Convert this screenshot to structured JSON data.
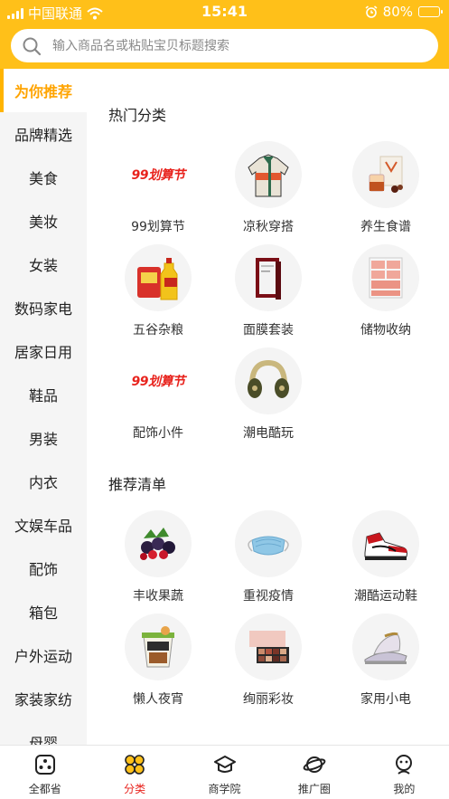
{
  "status_bar": {
    "carrier": "中国联通",
    "time": "15:41",
    "battery": "80%",
    "battery_level": 0.8
  },
  "search": {
    "placeholder": "输入商品名或粘贴宝贝标题搜索"
  },
  "sidebar": {
    "items": [
      {
        "label": "为你推荐",
        "active": true
      },
      {
        "label": "品牌精选"
      },
      {
        "label": "美食"
      },
      {
        "label": "美妆"
      },
      {
        "label": "女装"
      },
      {
        "label": "数码家电"
      },
      {
        "label": "居家日用"
      },
      {
        "label": "鞋品"
      },
      {
        "label": "男装"
      },
      {
        "label": "内衣"
      },
      {
        "label": "文娱车品"
      },
      {
        "label": "配饰"
      },
      {
        "label": "箱包"
      },
      {
        "label": "户外运动"
      },
      {
        "label": "家装家纺"
      },
      {
        "label": "母婴"
      }
    ]
  },
  "hot_categories": {
    "title": "热门分类",
    "items": [
      {
        "label": "99划算节",
        "icon": "brand-99-logo",
        "logo_text": "99划算节"
      },
      {
        "label": "凉秋穿搭",
        "icon": "jacket-icon"
      },
      {
        "label": "养生食谱",
        "icon": "tea-box-icon"
      },
      {
        "label": "五谷杂粮",
        "icon": "grain-oil-icon"
      },
      {
        "label": "面膜套装",
        "icon": "mask-box-icon"
      },
      {
        "label": "储物收纳",
        "icon": "storage-drawer-icon"
      },
      {
        "label": "配饰小件",
        "icon": "brand-99-logo",
        "logo_text": "99划算节"
      },
      {
        "label": "潮电酷玩",
        "icon": "headphones-icon"
      }
    ]
  },
  "recommend_list": {
    "title": "推荐清单",
    "items": [
      {
        "label": "丰收果蔬",
        "icon": "berries-icon"
      },
      {
        "label": "重视疫情",
        "icon": "face-mask-icon"
      },
      {
        "label": "潮酷运动鞋",
        "icon": "sneaker-icon"
      },
      {
        "label": "懒人夜宵",
        "icon": "snack-cup-icon"
      },
      {
        "label": "绚丽彩妆",
        "icon": "eyeshadow-palette-icon"
      },
      {
        "label": "家用小电",
        "icon": "iron-icon"
      }
    ]
  },
  "tabbar": {
    "items": [
      {
        "label": "全都省",
        "icon": "home-icon"
      },
      {
        "label": "分类",
        "icon": "category-icon",
        "active": true
      },
      {
        "label": "商学院",
        "icon": "graduation-cap-icon"
      },
      {
        "label": "推广圈",
        "icon": "planet-icon"
      },
      {
        "label": "我的",
        "icon": "profile-icon"
      }
    ]
  },
  "colors": {
    "accent": "#FFC019",
    "active_text": "#FFA400",
    "active_tab": "#E8231D"
  }
}
